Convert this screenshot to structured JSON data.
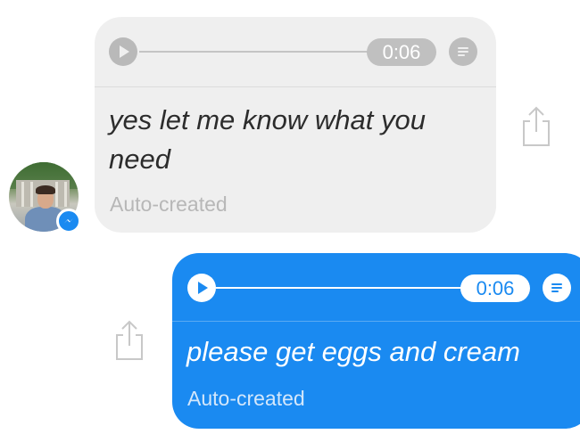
{
  "conversation": {
    "incoming": {
      "duration": "0:06",
      "transcript": "yes let me know what you need",
      "status": "Auto-created",
      "bubble_color": "#efefef",
      "progress": 0
    },
    "outgoing": {
      "duration": "0:06",
      "transcript": "please get eggs and cream",
      "status": "Auto-created",
      "bubble_color": "#1a8af1",
      "progress": 0
    }
  },
  "icons": {
    "play": "play-icon",
    "menu": "transcript-menu-icon",
    "share": "share-icon",
    "badge": "messenger-badge-icon"
  }
}
